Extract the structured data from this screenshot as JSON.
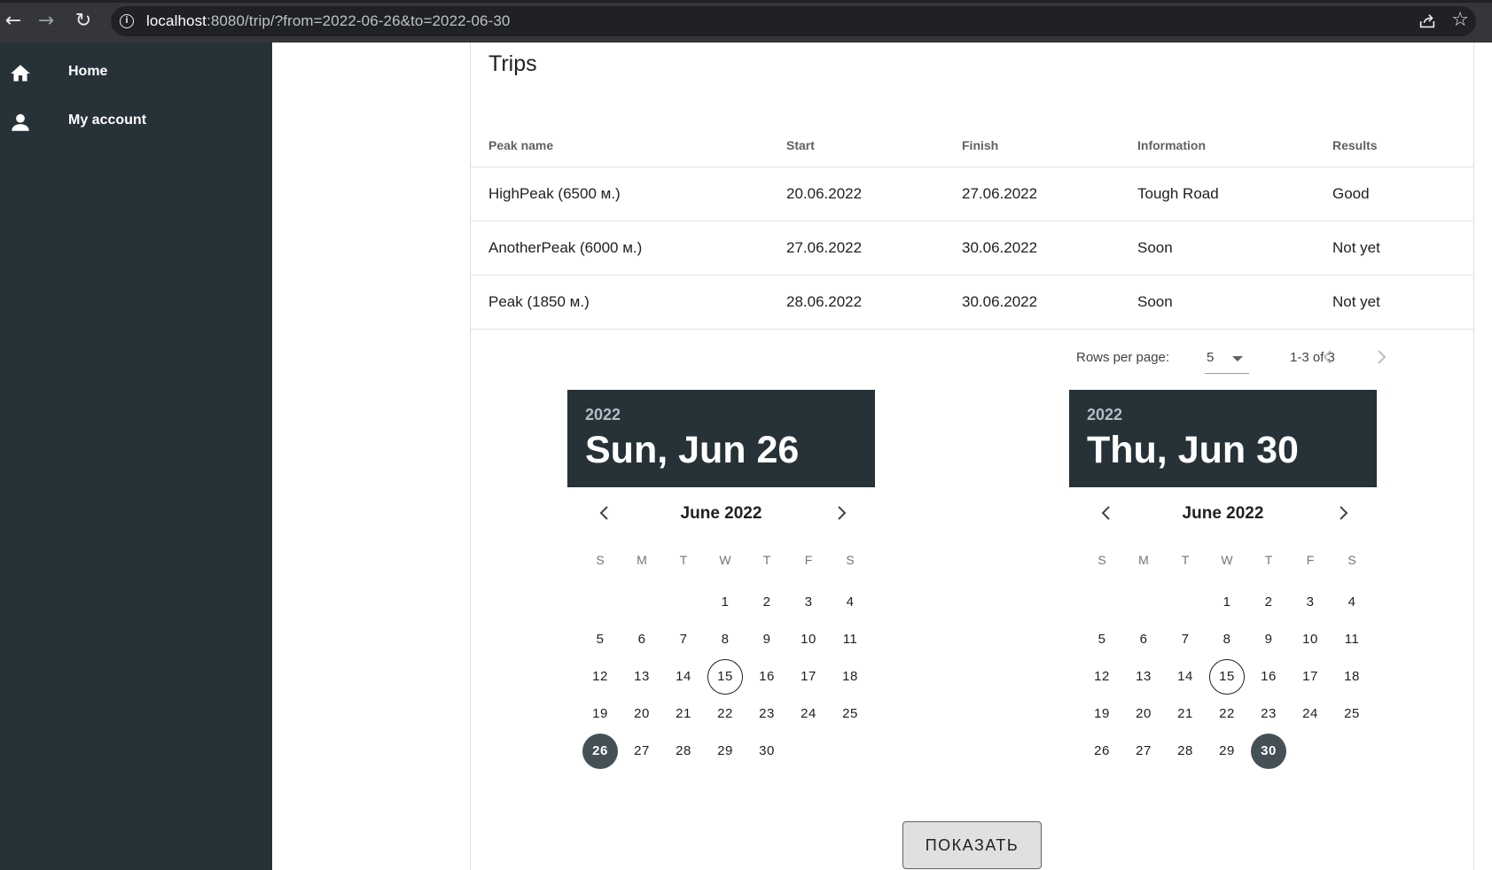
{
  "browser": {
    "url_host": "localhost",
    "url_rest": ":8080/trip/?from=2022-06-26&to=2022-06-30",
    "back_icon": "←",
    "forward_icon": "→",
    "reload_icon": "↻",
    "star_icon": "☆"
  },
  "sidebar": {
    "items": [
      {
        "label": "Home",
        "icon": "home-icon"
      },
      {
        "label": "My account",
        "icon": "person-icon"
      }
    ]
  },
  "trips": {
    "title": "Trips",
    "columns": [
      "Peak name",
      "Start",
      "Finish",
      "Information",
      "Results"
    ],
    "rows": [
      [
        "HighPeak (6500 м.)",
        "20.06.2022",
        "27.06.2022",
        "Tough Road",
        "Good"
      ],
      [
        "AnotherPeak (6000 м.)",
        "27.06.2022",
        "30.06.2022",
        "Soon",
        "Not yet"
      ],
      [
        "Peak (1850 м.)",
        "28.06.2022",
        "30.06.2022",
        "Soon",
        "Not yet"
      ]
    ],
    "pagination": {
      "rows_per_page_label": "Rows per page:",
      "rows_per_page": "5",
      "range": "1-3 of 3"
    }
  },
  "pickers": [
    {
      "year": "2022",
      "date_label": "Sun, Jun 26",
      "month_label": "June 2022",
      "weekdays": [
        "S",
        "M",
        "T",
        "W",
        "T",
        "F",
        "S"
      ],
      "first_weekday": 3,
      "days_in_month": 30,
      "today": 15,
      "selected": 26
    },
    {
      "year": "2022",
      "date_label": "Thu, Jun 30",
      "month_label": "June 2022",
      "weekdays": [
        "S",
        "M",
        "T",
        "W",
        "T",
        "F",
        "S"
      ],
      "first_weekday": 3,
      "days_in_month": 30,
      "today": 15,
      "selected": 30
    }
  ],
  "submit": {
    "label": "ПОКАЗАТЬ"
  },
  "colors": {
    "sidebar_bg": "#263238",
    "picker_header_bg": "#263238",
    "selected_day_bg": "#455056",
    "browser_bar_bg": "#35363a"
  }
}
